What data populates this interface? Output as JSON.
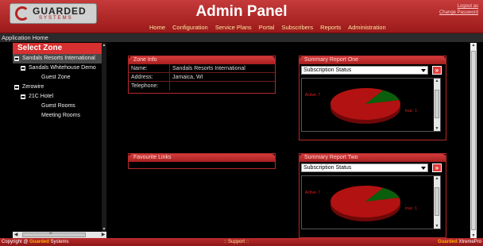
{
  "header": {
    "logo_text": "GUARDED",
    "logo_sub": "SYSTEMS",
    "title": "Admin Panel",
    "logout": "Logout as",
    "change_password": "Change Password"
  },
  "nav": [
    "Home",
    "Configuration",
    "Service Plans",
    "Portal",
    "Subscribers",
    "Reports",
    "Administration"
  ],
  "app_home": "Application Home",
  "sidebar": {
    "heading": "Select Zone",
    "tree": [
      {
        "label": "Sandals Resorts International",
        "level": 0,
        "expander": true,
        "selected": true
      },
      {
        "label": "Sandals Whitehouse Demo",
        "level": 1,
        "expander": true,
        "selected": false
      },
      {
        "label": "Guest Zone",
        "level": 2,
        "expander": false,
        "selected": false
      },
      {
        "label": "Zerowire",
        "level": 0,
        "expander": true,
        "selected": false
      },
      {
        "label": "21C Hotel",
        "level": 1,
        "expander": true,
        "selected": false
      },
      {
        "label": "Guest Rooms",
        "level": 2,
        "expander": false,
        "selected": false
      },
      {
        "label": "Meeting Rooms",
        "level": 2,
        "expander": false,
        "selected": false
      }
    ]
  },
  "zone_info": {
    "title": "Zone Info",
    "rows": [
      {
        "key": "Name:",
        "value": "Sandals Resorts International"
      },
      {
        "key": "Address:",
        "value": "Jamaica, WI"
      },
      {
        "key": "Telephone:",
        "value": ""
      }
    ]
  },
  "favourite_links": {
    "title": "Favourite Links"
  },
  "summary_one": {
    "title": "Summary Report One",
    "select_value": "Subscription Status"
  },
  "summary_two": {
    "title": "Summary Report Two",
    "select_value": "Subscription Status"
  },
  "chart_data": [
    {
      "type": "pie",
      "slices": [
        {
          "label": "Active: 7",
          "value": 7,
          "color": "#b31212"
        },
        {
          "label": "Inac: 1",
          "value": 1,
          "color": "#0b5e0b"
        }
      ]
    },
    {
      "type": "pie",
      "slices": [
        {
          "label": "Active: 7",
          "value": 7,
          "color": "#b31212"
        },
        {
          "label": "Inac: 1",
          "value": 1,
          "color": "#0b5e0b"
        }
      ]
    }
  ],
  "footer": {
    "copyright_prefix": "Copyright @",
    "brand": "Guarded",
    "copyright_suffix": "Systems",
    "support": ":: Support ::",
    "right_brand": "Guarded",
    "right_suffix": "XtremePro"
  },
  "colors": {
    "brand_red": "#b52222",
    "accent_gold": "#ffb000"
  }
}
